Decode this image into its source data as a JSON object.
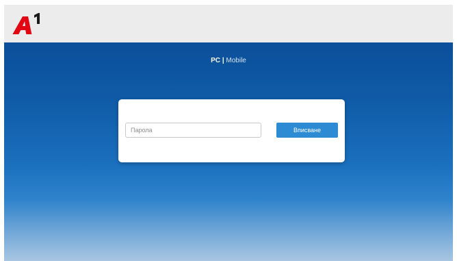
{
  "brand": {
    "logo_text": "A1",
    "logo_color": "#e30613"
  },
  "switcher": {
    "pc_label": "PC",
    "separator": "|",
    "mobile_label": "Mobile"
  },
  "login": {
    "password_placeholder": "Парола",
    "password_value": "",
    "submit_label": "Вписване",
    "button_color": "#2d8bd4"
  },
  "colors": {
    "topbar": "#ececec",
    "hero_top": "#0b4f9a",
    "hero_bottom": "#a9c6e2"
  }
}
